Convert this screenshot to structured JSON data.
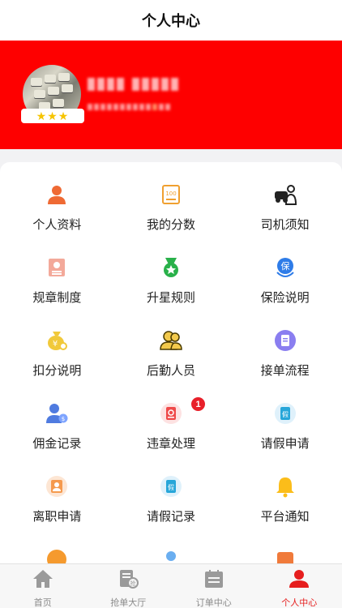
{
  "header": {
    "title": "个人中心"
  },
  "profile": {
    "stars": "★★★"
  },
  "menu": [
    {
      "label": "个人资料",
      "icon": "user-icon"
    },
    {
      "label": "我的分数",
      "icon": "score-icon"
    },
    {
      "label": "司机须知",
      "icon": "driver-icon"
    },
    {
      "label": "规章制度",
      "icon": "rules-doc-icon"
    },
    {
      "label": "升星规则",
      "icon": "medal-icon"
    },
    {
      "label": "保险说明",
      "icon": "insurance-icon"
    },
    {
      "label": "扣分说明",
      "icon": "money-bag-icon"
    },
    {
      "label": "后勤人员",
      "icon": "staff-icon"
    },
    {
      "label": "接单流程",
      "icon": "process-icon"
    },
    {
      "label": "佣金记录",
      "icon": "commission-icon"
    },
    {
      "label": "违章处理",
      "icon": "violation-icon"
    },
    {
      "label": "请假申请",
      "icon": "leave-request-icon"
    },
    {
      "label": "离职申请",
      "icon": "resignation-icon"
    },
    {
      "label": "请假记录",
      "icon": "leave-record-icon"
    },
    {
      "label": "平台通知",
      "icon": "bell-icon"
    }
  ],
  "badges": {
    "violation_count": "1"
  },
  "tabbar": [
    {
      "label": "首页",
      "icon": "home-icon"
    },
    {
      "label": "抢单大厅",
      "icon": "grab-order-icon"
    },
    {
      "label": "订单中心",
      "icon": "order-list-icon"
    },
    {
      "label": "个人中心",
      "icon": "person-icon"
    }
  ],
  "colors": {
    "brand": "#fe0000",
    "active_tab": "#e61e1e"
  }
}
